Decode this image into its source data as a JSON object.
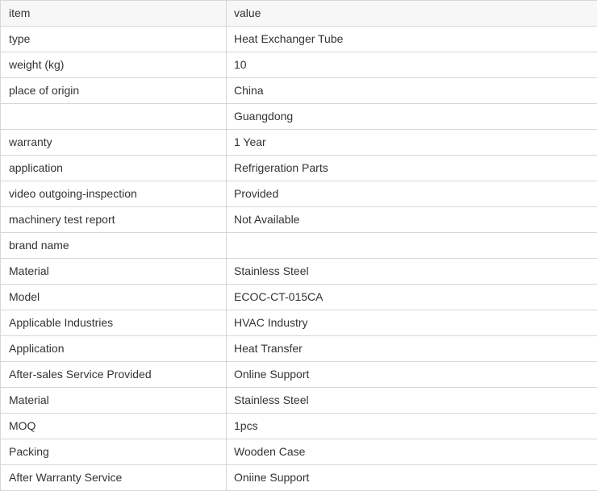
{
  "table": {
    "headers": [
      "item",
      "value"
    ],
    "rows": [
      [
        "type",
        "Heat Exchanger Tube"
      ],
      [
        "weight (kg)",
        "10"
      ],
      [
        "place of origin",
        "China"
      ],
      [
        "",
        "Guangdong"
      ],
      [
        "warranty",
        "1 Year"
      ],
      [
        "application",
        "Refrigeration Parts"
      ],
      [
        "video outgoing-inspection",
        "Provided"
      ],
      [
        "machinery test report",
        "Not Available"
      ],
      [
        "brand name",
        ""
      ],
      [
        "Material",
        "Stainless Steel"
      ],
      [
        "Model",
        "ECOC-CT-015CA"
      ],
      [
        "Applicable Industries",
        "HVAC Industry"
      ],
      [
        "Application",
        "Heat Transfer"
      ],
      [
        "After-sales Service Provided",
        "Online Support"
      ],
      [
        "Material",
        "Stainless Steel"
      ],
      [
        "MOQ",
        "1pcs"
      ],
      [
        "Packing",
        "Wooden Case"
      ],
      [
        "After Warranty Service",
        "Oniine Support"
      ]
    ]
  },
  "colors": {
    "border": "#d7d7d7",
    "header_background": "#f7f7f7",
    "text": "#333333"
  }
}
